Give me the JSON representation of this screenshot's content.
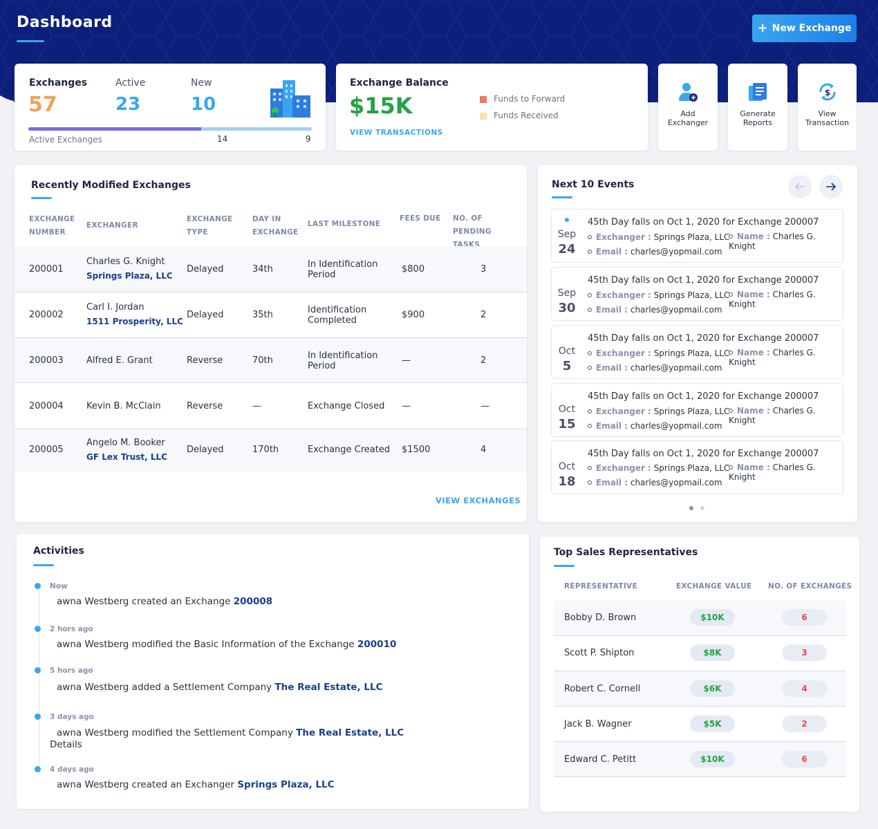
{
  "header": {
    "title": "Dashboard",
    "new_button": "New Exchange"
  },
  "stats": {
    "exchanges_label": "Exchanges",
    "exchanges_value": "57",
    "active_label": "Active",
    "active_value": "23",
    "new_label": "New",
    "new_value": "10",
    "footer_label": "Active Exchanges",
    "footer_left": "14",
    "footer_right": "9",
    "progress_fraction": 0.61
  },
  "balance": {
    "title": "Exchange Balance",
    "value": "$15K",
    "link": "VIEW TRANSACTIONS",
    "legend": [
      {
        "label": "Funds to Forward",
        "color": "#ec7b5d"
      },
      {
        "label": "Funds Received",
        "color": "#f6e4a8"
      }
    ]
  },
  "quick_actions": [
    {
      "label": "Add Exchanger",
      "icon": "add-user-icon"
    },
    {
      "label": "Generate Reports",
      "icon": "report-icon"
    },
    {
      "label": "View Transaction",
      "icon": "transaction-icon"
    }
  ],
  "recent": {
    "title": "Recently Modified Exchanges",
    "columns": [
      "EXCHANGE NUMBER",
      "EXCHANGER",
      "EXCHANGE TYPE",
      "DAY IN EXCHANGE",
      "LAST MILESTONE",
      "FEES DUE",
      "NO. OF PENDING TASKS"
    ],
    "rows": [
      {
        "number": "200001",
        "exchanger": "Charles G. Knight",
        "company": "Springs Plaza, LLC",
        "type": "Delayed",
        "day": "34th",
        "milestone": "In Identification Period",
        "fees": "$800",
        "tasks": "3"
      },
      {
        "number": "200002",
        "exchanger": "Carl I. Jordan",
        "company": "1511 Prosperity, LLC",
        "type": "Delayed",
        "day": "35th",
        "milestone": "Identification Completed",
        "fees": "$900",
        "tasks": "2"
      },
      {
        "number": "200003",
        "exchanger": "Alfred E. Grant",
        "company": "",
        "type": "Reverse",
        "day": "70th",
        "milestone": "In Identification Period",
        "fees": "—",
        "tasks": "2"
      },
      {
        "number": "200004",
        "exchanger": "Kevin B. McClain",
        "company": "",
        "type": "Reverse",
        "day": "—",
        "milestone": "Exchange Closed",
        "fees": "—",
        "tasks": "—"
      },
      {
        "number": "200005",
        "exchanger": "Angelo M. Booker",
        "company": "GF Lex Trust, LLC",
        "type": "Delayed",
        "day": "170th",
        "milestone": "Exchange Created",
        "fees": "$1500",
        "tasks": "4"
      }
    ],
    "link": "VIEW EXCHANGES"
  },
  "events": {
    "title": "Next 10 Events",
    "exchanger_key": "Exchanger :",
    "name_key": "Name :",
    "email_key": "Email :",
    "items": [
      {
        "month": "Sep",
        "day": "24",
        "title": "45th Day falls on Oct 1, 2020 for Exchange 200007",
        "exchanger": "Springs Plaza, LLC",
        "name": "Charles G. Knight",
        "email": "charles@yopmail.com"
      },
      {
        "month": "Sep",
        "day": "30",
        "title": "45th Day falls on Oct 1, 2020 for Exchange 200007",
        "exchanger": "Springs Plaza, LLC",
        "name": "Charles G. Knight",
        "email": "charles@yopmail.com"
      },
      {
        "month": "Oct",
        "day": "5",
        "title": "45th Day falls on Oct 1, 2020 for Exchange 200007",
        "exchanger": "Springs Plaza, LLC",
        "name": "Charles G. Knight",
        "email": "charles@yopmail.com"
      },
      {
        "month": "Oct",
        "day": "15",
        "title": "45th Day falls on Oct 1, 2020 for Exchange 200007",
        "exchanger": "Springs Plaza, LLC",
        "name": "Charles G. Knight",
        "email": "charles@yopmail.com"
      },
      {
        "month": "Oct",
        "day": "18",
        "title": "45th Day falls on Oct 1, 2020 for Exchange 200007",
        "exchanger": "Springs Plaza, LLC",
        "name": "Charles G. Knight",
        "email": "charles@yopmail.com"
      }
    ]
  },
  "activities": {
    "title": "Activities",
    "items": [
      {
        "time": "Now",
        "text": "awna Westberg created an Exchange ",
        "highlight": "200008",
        "extra": ""
      },
      {
        "time": "2 hors ago",
        "text": "awna Westberg modified the Basic Information of the Exchange ",
        "highlight": "200010",
        "extra": ""
      },
      {
        "time": "5 hors ago",
        "text": "awna Westberg added a Settlement Company ",
        "highlight": "The Real Estate, LLC",
        "extra": ""
      },
      {
        "time": "3 days ago",
        "text": "awna Westberg modified the Settlement Company ",
        "highlight": "The Real Estate, LLC",
        "extra": "Details"
      },
      {
        "time": "4 days ago",
        "text": "awna Westberg created an Exchanger ",
        "highlight": "Springs Plaza, LLC",
        "extra": ""
      }
    ]
  },
  "sales": {
    "title": "Top Sales Representatives",
    "columns": [
      "REPRESENTATIVE",
      "EXCHANGE VALUE",
      "NO. OF EXCHANGES"
    ],
    "rows": [
      {
        "name": "Bobby D. Brown",
        "value": "$10K",
        "count": "6"
      },
      {
        "name": "Scott P. Shipton",
        "value": "$8K",
        "count": "3"
      },
      {
        "name": "Robert C. Cornell",
        "value": "$6K",
        "count": "4"
      },
      {
        "name": "Jack B. Wagner",
        "value": "$5K",
        "count": "2"
      },
      {
        "name": "Edward C. Petitt",
        "value": "$10K",
        "count": "6"
      }
    ]
  }
}
